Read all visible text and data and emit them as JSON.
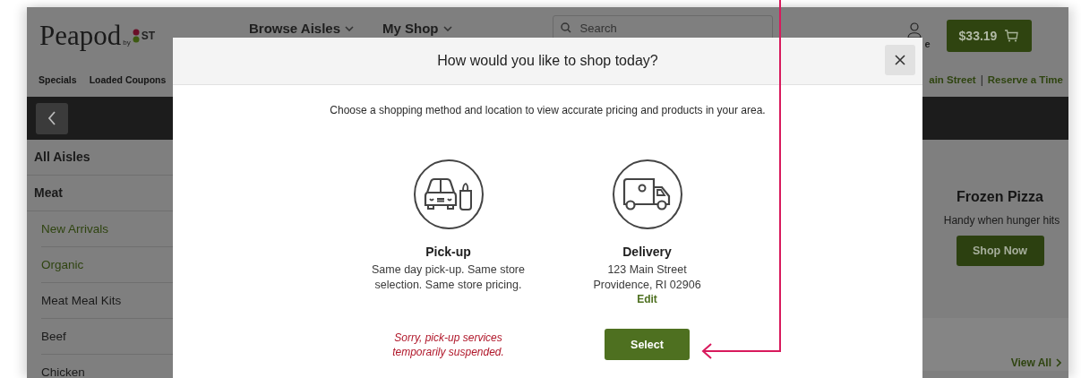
{
  "header": {
    "logo": {
      "name": "Peapod",
      "by": "by",
      "partner": "ST"
    },
    "nav": [
      {
        "label": "Browse Aisles"
      },
      {
        "label": "My Shop"
      }
    ],
    "search": {
      "placeholder": "Search"
    },
    "account": {
      "label": "e"
    },
    "cart": {
      "total": "$33.19"
    }
  },
  "subnav": {
    "links": [
      "Specials",
      "Loaded Coupons"
    ],
    "location": {
      "links": [
        "ain Street",
        "Reserve a Time"
      ],
      "separator": "|"
    }
  },
  "sidebar": {
    "items": [
      {
        "label": "All Aisles"
      },
      {
        "label": "Meat",
        "children": [
          {
            "label": "New Arrivals",
            "featured": true
          },
          {
            "label": "Organic",
            "featured": true
          },
          {
            "label": "Meat Meal Kits",
            "featured": false
          },
          {
            "label": "Beef",
            "featured": false
          },
          {
            "label": "Chicken",
            "featured": false
          }
        ]
      }
    ]
  },
  "promo": {
    "title": "Frozen Pizza",
    "subtitle": "Handy when hunger hits",
    "button": "Shop Now",
    "view_all": "View All"
  },
  "modal": {
    "title": "How would you like to shop today?",
    "intro": "Choose a shopping method and location to view accurate pricing and products in your area.",
    "options": [
      {
        "kind": "pickup",
        "title": "Pick-up",
        "lines": [
          "Same day pick-up. Same store selection. Same store pricing."
        ],
        "available": false,
        "notice": "Sorry, pick-up services temporarily suspended."
      },
      {
        "kind": "delivery",
        "title": "Delivery",
        "lines": [
          "123 Main Street",
          "Providence, RI 02906"
        ],
        "edit": "Edit",
        "available": true,
        "button": "Select"
      }
    ]
  },
  "annotation": {
    "kind": "arrow"
  }
}
